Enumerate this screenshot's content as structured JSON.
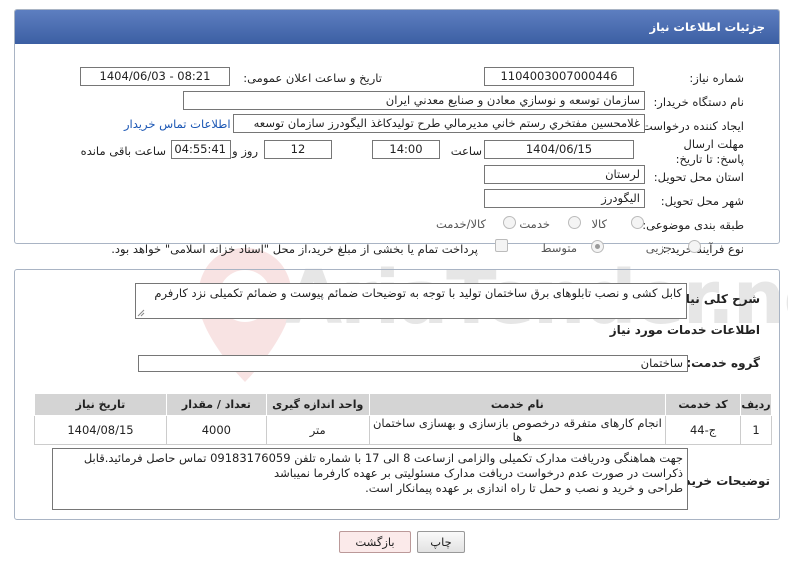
{
  "header": {
    "title": "جزئیات اطلاعات نیاز"
  },
  "form": {
    "need_number_label": "شماره نیاز:",
    "need_number": "1104003007000446",
    "announce_label": "تاریخ و ساعت اعلان عمومی:",
    "announce_value": "1404/06/03 - 08:21",
    "buyer_org_label": "نام دستگاه خریدار:",
    "buyer_org": "سازمان توسعه و نوسازي معادن و صنايع معدني ايران",
    "creator_label": "ایجاد کننده درخواست:",
    "creator": "غلامحسين مفتخري رستم خاني مديرمالي طرح توليدكاغذ اليگودرز سازمان توسعه",
    "contact_link": "اطلاعات تماس خریدار",
    "deadline_label": "مهلت ارسال پاسخ: تا تاریخ:",
    "deadline_date": "1404/06/15",
    "time_label": "ساعت",
    "deadline_time": "14:00",
    "days_value": "12",
    "days_label": "روز و",
    "remaining_time": "04:55:41",
    "remaining_label": "ساعت باقی مانده",
    "province_label": "استان محل تحویل:",
    "province": "لرستان",
    "city_label": "شهر محل تحویل:",
    "city": "اليگودرز",
    "category_label": "طبقه بندی موضوعی:",
    "category_options": [
      "کالا",
      "خدمت",
      "کالا/خدمت"
    ],
    "process_label": "نوع فرآیند خرید :",
    "process_options": [
      "جزیی",
      "متوسط"
    ],
    "payment_note": "پرداخت تمام یا بخشی از مبلغ خرید،از محل \"اسناد خزانه اسلامی\" خواهد بود."
  },
  "description": {
    "label": "شرح کلی نیاز:",
    "text": "کابل کشی و نصب تابلوهای برق ساختمان تولید با توجه به توضیحات ضمائم پیوست و ضمائم تکمیلی نزد کارفرم"
  },
  "services": {
    "section_title": "اطلاعات خدمات مورد نیاز",
    "group_label": "گروه خدمت:",
    "group_value": "ساختمان",
    "columns": [
      "ردیف",
      "کد خدمت",
      "نام خدمت",
      "واحد اندازه گیری",
      "تعداد / مقدار",
      "تاریخ نیاز"
    ],
    "rows": [
      [
        "1",
        "ج-44",
        "انجام کارهای متفرقه درخصوص بازسازی و بهسازی ساختمان ها",
        "متر",
        "4000",
        "1404/08/15"
      ]
    ]
  },
  "buyer_notes": {
    "label": "توضیحات خریدار:",
    "line1": "جهت هماهنگی ودریافت مدارک تکمیلی والزامی ازساعت 8 الی 17 با شماره تلفن 09183176059 تماس حاصل فرمائید.قابل",
    "line2": "ذکراست در صورت عدم درخواست دریافت مدارک مسئولیتی بر عهده کارفرما نمیباشد",
    "line3": "طراحی و خرید و نصب و حمل تا راه اندازی بر عهده پیمانکار است."
  },
  "buttons": {
    "print": "چاپ",
    "back": "بازگشت"
  },
  "watermark": {
    "text": "AriaTender.neT"
  }
}
